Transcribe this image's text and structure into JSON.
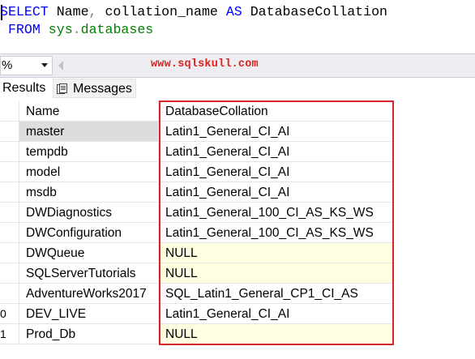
{
  "editor": {
    "line1": {
      "kw1": "SELECT",
      "t1": " Name",
      "p1": ",",
      "t2": " collation_name ",
      "kw2": "AS",
      "t3": " DatabaseCollation"
    },
    "line2": {
      "kw1": "FROM",
      "obj": "sys",
      "p1": ".",
      "obj2": "databases"
    }
  },
  "status": {
    "zoom": "%",
    "watermark": "www.sqlskull.com"
  },
  "tabs": {
    "results": "Results",
    "messages": "Messages"
  },
  "grid": {
    "columns": [
      "Name",
      "DatabaseCollation"
    ],
    "rows": [
      {
        "num": "",
        "name": "master",
        "collation": "Latin1_General_CI_AI",
        "is_null": false
      },
      {
        "num": "",
        "name": "tempdb",
        "collation": "Latin1_General_CI_AI",
        "is_null": false
      },
      {
        "num": "",
        "name": "model",
        "collation": "Latin1_General_CI_AI",
        "is_null": false
      },
      {
        "num": "",
        "name": "msdb",
        "collation": "Latin1_General_CI_AI",
        "is_null": false
      },
      {
        "num": "",
        "name": "DWDiagnostics",
        "collation": "Latin1_General_100_CI_AS_KS_WS",
        "is_null": false
      },
      {
        "num": "",
        "name": "DWConfiguration",
        "collation": "Latin1_General_100_CI_AS_KS_WS",
        "is_null": false
      },
      {
        "num": "",
        "name": "DWQueue",
        "collation": "NULL",
        "is_null": true
      },
      {
        "num": "",
        "name": "SQLServerTutorials",
        "collation": "NULL",
        "is_null": true
      },
      {
        "num": "",
        "name": "AdventureWorks2017",
        "collation": "SQL_Latin1_General_CP1_CI_AS",
        "is_null": false
      },
      {
        "num": "0",
        "name": "DEV_LIVE",
        "collation": "Latin1_General_CI_AI",
        "is_null": false
      },
      {
        "num": "1",
        "name": "Prod_Db",
        "collation": "NULL",
        "is_null": true
      }
    ]
  },
  "colors": {
    "keyword": "#0000ff",
    "system_object": "#008000",
    "watermark": "#e0201c",
    "highlight_box": "#d6262c",
    "null_cell": "#ffffe1"
  }
}
